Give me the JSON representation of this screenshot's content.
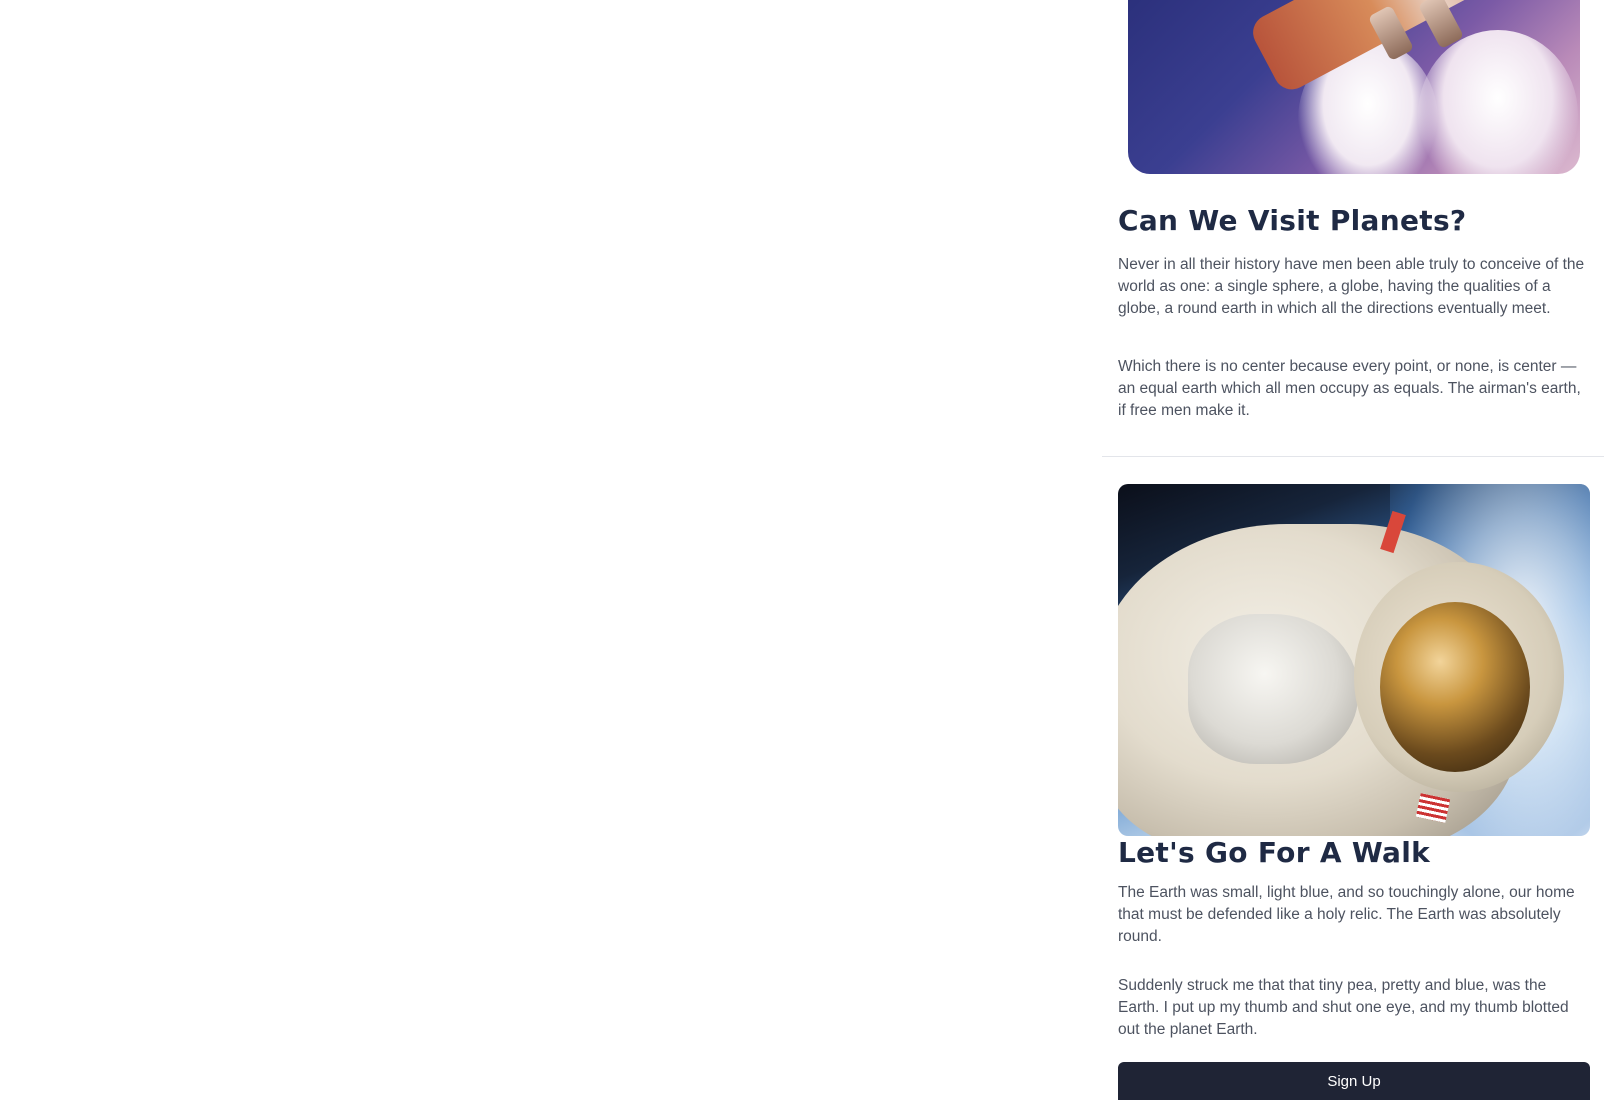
{
  "sections": [
    {
      "title": "Can We Visit Planets?",
      "paragraphs": [
        "Never in all their history have men been able truly to conceive of the world as one: a single sphere, a globe, having the qualities of a globe, a round earth in which all the directions eventually meet.",
        "Which there is no center because every point, or none, is center — an equal earth which all men occupy as equals. The airman's earth, if free men make it."
      ]
    },
    {
      "title": "Let's Go For A Walk",
      "paragraphs": [
        "The Earth was small, light blue, and so touchingly alone, our home that must be defended like a holy relic. The Earth was absolutely round.",
        "Suddenly struck me that that tiny pea, pretty and blue, was the Earth. I put up my thumb and shut one eye, and my thumb blotted out the planet Earth."
      ]
    }
  ],
  "signup": {
    "label": "Sign Up"
  },
  "colors": {
    "heading": "#1f2a44",
    "body_text": "#4d5360",
    "button_bg": "#1f2435",
    "button_text": "#ffffff",
    "divider": "#e3e5ea"
  }
}
